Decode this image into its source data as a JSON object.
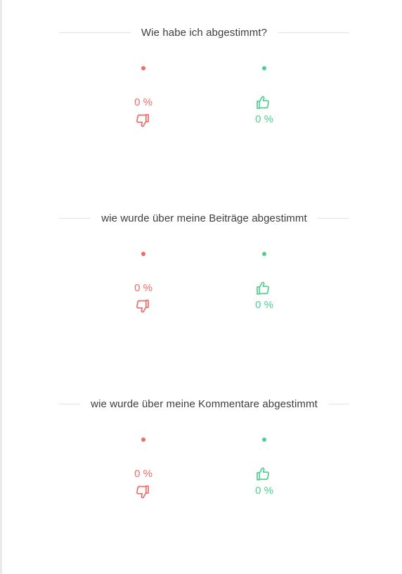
{
  "sections": [
    {
      "title": "Wie habe ich abgestimmt?",
      "downvote": {
        "percent": "0 %",
        "color": "#ee6b6b",
        "icon": "thumbs-down-icon"
      },
      "upvote": {
        "percent": "0 %",
        "color": "#4fcf8e",
        "icon": "thumbs-up-icon"
      }
    },
    {
      "title": "wie wurde über meine Beiträge abgestimmt",
      "downvote": {
        "percent": "0 %",
        "color": "#ee6b6b",
        "icon": "thumbs-down-icon"
      },
      "upvote": {
        "percent": "0 %",
        "color": "#4fcf8e",
        "icon": "thumbs-up-icon"
      }
    },
    {
      "title": "wie wurde über meine Kommentare abgestimmt",
      "downvote": {
        "percent": "0 %",
        "color": "#ee6b6b",
        "icon": "thumbs-down-icon"
      },
      "upvote": {
        "percent": "0 %",
        "color": "#4fcf8e",
        "icon": "thumbs-up-icon"
      }
    }
  ]
}
